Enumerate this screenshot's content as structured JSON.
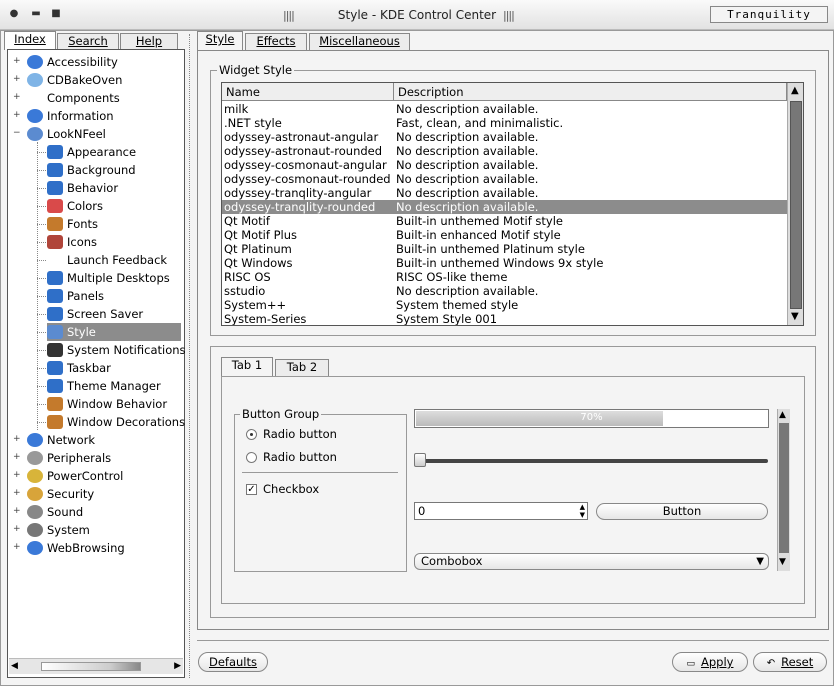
{
  "window": {
    "title": "Style - KDE Control Center",
    "brand": "Tranquility"
  },
  "left_tabs": [
    "Index",
    "Search",
    "Help"
  ],
  "tree": [
    {
      "label": "Accessibility",
      "icon": "accessibility-icon",
      "level": 0,
      "color": "#3a79d8"
    },
    {
      "label": "CDBakeOven",
      "icon": "folder-icon",
      "level": 0,
      "color": "#7fb4e6"
    },
    {
      "label": "Components",
      "icon": "none",
      "level": 0,
      "color": ""
    },
    {
      "label": "Information",
      "icon": "information-icon",
      "level": 0,
      "color": "#3a79d8"
    },
    {
      "label": "LookNFeel",
      "icon": "looknfeel-icon",
      "level": 0,
      "color": "#5b8bd0"
    },
    {
      "label": "Appearance",
      "icon": "appearance-icon",
      "level": 1,
      "color": "#2f6fc8"
    },
    {
      "label": "Background",
      "icon": "background-icon",
      "level": 1,
      "color": "#2f6fc8"
    },
    {
      "label": "Behavior",
      "icon": "behavior-icon",
      "level": 1,
      "color": "#2f6fc8"
    },
    {
      "label": "Colors",
      "icon": "colors-icon",
      "level": 1,
      "color": "#d94a4a"
    },
    {
      "label": "Fonts",
      "icon": "fonts-icon",
      "level": 1,
      "color": "#c47a2c"
    },
    {
      "label": "Icons",
      "icon": "icons-icon",
      "level": 1,
      "color": "#b0453a"
    },
    {
      "label": "Launch Feedback",
      "icon": "none",
      "level": 1,
      "color": ""
    },
    {
      "label": "Multiple Desktops",
      "icon": "desktops-icon",
      "level": 1,
      "color": "#2f6fc8"
    },
    {
      "label": "Panels",
      "icon": "panels-icon",
      "level": 1,
      "color": "#2f6fc8"
    },
    {
      "label": "Screen Saver",
      "icon": "screensaver-icon",
      "level": 1,
      "color": "#2f6fc8"
    },
    {
      "label": "Style",
      "icon": "style-icon",
      "level": 1,
      "color": "#5b8bd0",
      "selected": true
    },
    {
      "label": "System Notifications",
      "icon": "notifications-icon",
      "level": 1,
      "color": "#333"
    },
    {
      "label": "Taskbar",
      "icon": "taskbar-icon",
      "level": 1,
      "color": "#2f6fc8"
    },
    {
      "label": "Theme Manager",
      "icon": "theme-manager-icon",
      "level": 1,
      "color": "#2f6fc8"
    },
    {
      "label": "Window Behavior",
      "icon": "window-behavior-icon",
      "level": 1,
      "color": "#c47a2c"
    },
    {
      "label": "Window Decorations",
      "icon": "window-decorations-icon",
      "level": 1,
      "color": "#c47a2c"
    },
    {
      "label": "Network",
      "icon": "network-icon",
      "level": 0,
      "color": "#3a79d8"
    },
    {
      "label": "Peripherals",
      "icon": "peripherals-icon",
      "level": 0,
      "color": "#999"
    },
    {
      "label": "PowerControl",
      "icon": "power-icon",
      "level": 0,
      "color": "#d8b43a"
    },
    {
      "label": "Security",
      "icon": "lock-icon",
      "level": 0,
      "color": "#d8a43a"
    },
    {
      "label": "Sound",
      "icon": "sound-icon",
      "level": 0,
      "color": "#888"
    },
    {
      "label": "System",
      "icon": "system-icon",
      "level": 0,
      "color": "#777"
    },
    {
      "label": "WebBrowsing",
      "icon": "web-icon",
      "level": 0,
      "color": "#3a79d8"
    }
  ],
  "right_tabs": [
    "Style",
    "Effects",
    "Miscellaneous"
  ],
  "widget_style": {
    "group_label": "Widget Style",
    "columns": [
      "Name",
      "Description"
    ],
    "rows": [
      [
        "milk",
        "No description available."
      ],
      [
        ".NET style",
        "Fast, clean, and minimalistic."
      ],
      [
        "odyssey-astronaut-angular",
        "No description available."
      ],
      [
        "odyssey-astronaut-rounded",
        "No description available."
      ],
      [
        "odyssey-cosmonaut-angular",
        "No description available."
      ],
      [
        "odyssey-cosmonaut-rounded",
        "No description available."
      ],
      [
        "odyssey-tranqlity-angular",
        "No description available."
      ],
      [
        "odyssey-tranqlity-rounded",
        "No description available."
      ],
      [
        "Qt Motif",
        "Built-in unthemed Motif style"
      ],
      [
        "Qt Motif Plus",
        "Built-in enhanced Motif style"
      ],
      [
        "Qt Platinum",
        "Built-in unthemed Platinum style"
      ],
      [
        "Qt Windows",
        "Built-in unthemed Windows 9x style"
      ],
      [
        "RISC OS",
        "RISC OS-like theme"
      ],
      [
        "sstudio",
        "No description available."
      ],
      [
        "System++",
        "System themed style"
      ],
      [
        "System-Series",
        "System Style 001"
      ]
    ],
    "selected_index": 7
  },
  "preview": {
    "tabs": [
      "Tab 1",
      "Tab 2"
    ],
    "group_label": "Button Group",
    "radio1": "Radio button",
    "radio2": "Radio button",
    "checkbox": "Checkbox",
    "progress_text": "70%",
    "progress": 0.7,
    "spin_value": "0",
    "button": "Button",
    "combobox": "Combobox"
  },
  "bottom": {
    "defaults": "Defaults",
    "apply": "Apply",
    "reset": "Reset"
  }
}
